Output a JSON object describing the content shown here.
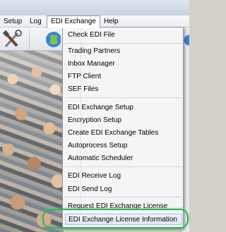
{
  "menubar": {
    "items": [
      {
        "label": "Setup"
      },
      {
        "label": "Log"
      },
      {
        "label": "EDI Exchange"
      },
      {
        "label": "Help"
      }
    ]
  },
  "toolbar": {
    "icons": [
      "tools-icon",
      "globe-icon"
    ]
  },
  "dropdown": {
    "items": [
      {
        "label": "Check EDI File"
      },
      {
        "label": "Trading Partners"
      },
      {
        "label": "Inbox Manager"
      },
      {
        "label": "FTP Client"
      },
      {
        "label": "SEF Files"
      },
      {
        "label": "EDI Exchange Setup"
      },
      {
        "label": "Encryption Setup"
      },
      {
        "label": "Create EDI Exchange Tables"
      },
      {
        "label": "Autoprocess Setup"
      },
      {
        "label": "Automatic Scheduler"
      },
      {
        "label": "EDI Receive Log"
      },
      {
        "label": "EDI Send Log"
      },
      {
        "label": "Request EDI Exchange License"
      },
      {
        "label": "EDI Exchange License Information"
      }
    ],
    "highlighted": "EDI Exchange License Information"
  },
  "colors": {
    "highlight_ring": "#2db55a",
    "menu_background": "#f5f5f5"
  }
}
